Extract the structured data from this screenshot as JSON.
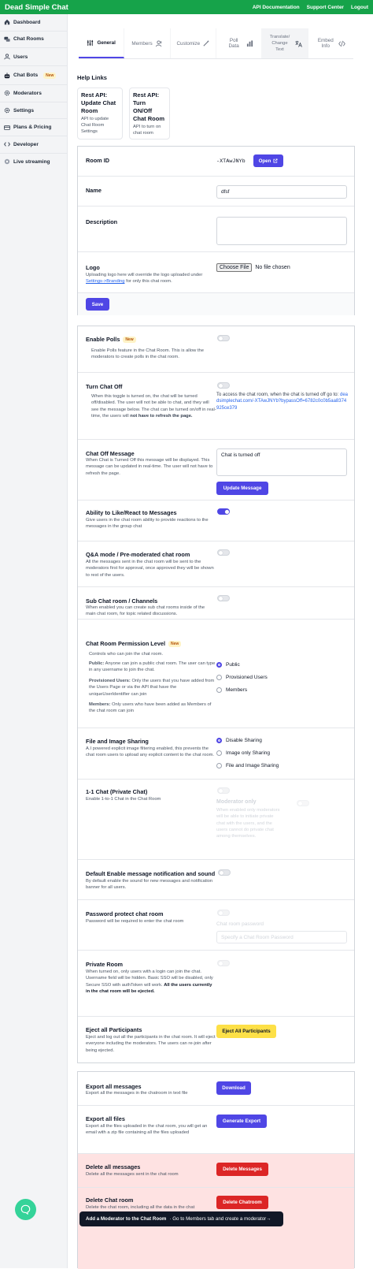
{
  "header": {
    "brand": "Dead Simple Chat",
    "links": [
      "API Documentation",
      "Support Center",
      "Logout"
    ]
  },
  "sidebar": {
    "items": [
      {
        "label": "Dashboard",
        "icon": "home-icon"
      },
      {
        "label": "Chat Rooms",
        "icon": "chat-bubbles-icon"
      },
      {
        "label": "Users",
        "icon": "users-icon"
      },
      {
        "label": "Chat Bots",
        "icon": "bot-icon",
        "badge": "New"
      },
      {
        "label": "Moderators",
        "icon": "gear-icon"
      },
      {
        "label": "Settings",
        "icon": "gear-icon"
      },
      {
        "label": "Plans & Pricing",
        "icon": "credit-card-icon"
      },
      {
        "label": "Developer",
        "icon": "code-icon"
      },
      {
        "label": "Live streaming",
        "icon": "broadcast-icon"
      }
    ]
  },
  "tabs": [
    {
      "label": "General",
      "icon": "sliders-icon",
      "active": true
    },
    {
      "label": "Members",
      "icon": "users-icon"
    },
    {
      "label": "Customize",
      "icon": "wand-icon"
    },
    {
      "label": "Poll Data",
      "icon": "bar-chart-icon"
    },
    {
      "label": "Translate/ Change Text",
      "icon": "translate-icon"
    },
    {
      "label": "Embed Info",
      "icon": "code-icon"
    }
  ],
  "help": {
    "title": "Help Links",
    "cards": [
      {
        "title": "Rest API: Update Chat Room",
        "desc": "API to update Chat Room Settings"
      },
      {
        "title": "Rest API: Turn ON/Off Chat Room",
        "desc": "API to turn on chat room"
      }
    ]
  },
  "basic": {
    "room_id_label": "Room ID",
    "room_id_value": "-XTAwJNYb",
    "open_label": "Open",
    "name_label": "Name",
    "name_value": "dfsf",
    "description_label": "Description",
    "description_value": "",
    "logo_label": "Logo",
    "logo_desc_pre": "Uploading logo here will override the logo uploaded under ",
    "logo_desc_link": "Settings->Branding",
    "logo_desc_post": " for only this chat room.",
    "file_button": "Choose File",
    "file_status": "No file chosen",
    "save_label": "Save"
  },
  "features": {
    "polls": {
      "label": "Enable Polls",
      "badge": "New",
      "desc": "Enable Polls feature in the Chat Room. This is allow the moderators to create polls in the chat room."
    },
    "chat_off": {
      "label": "Turn Chat Off",
      "desc_plain": "When this toggle is turned on, the chat will be turned off/disabled. The user will not be able to chat, and they will see the message below. The chat can be turned on/off in real-time, the users will ",
      "desc_bold": "not have to refresh the page.",
      "access_text": "To access the chat room, when the chat is turned off go to: ",
      "access_link": "deadsimplechat.com/-XTAwJNYb?bypassOff=6782c0c0b5aa8374925ce379"
    },
    "chat_off_message": {
      "label": "Chat Off Message",
      "desc": "When Chat is Turned Off this message will be displayed. This message can be updated in real-time. The user will not have to refresh the page.",
      "value": "Chat is turned off",
      "button": "Update Message"
    },
    "like": {
      "label": "Ability to Like/React to Messages",
      "desc": "Give users in the chat room ability to provide reactions to the messages in the group chat"
    },
    "qa": {
      "label": "Q&A mode / Pre-moderated chat room",
      "desc": "All the messages sent in the chat room will be sent to the moderators first for approval, once approved they will be shown to rest of the users."
    },
    "sub_rooms": {
      "label": "Sub Chat room / Channels",
      "desc": "When enabled you can create sub chat rooms inside of the main chat room, for topic related discussions."
    },
    "permission": {
      "label": "Chat Room Permission Level",
      "badge": "New",
      "desc": "Controls who can join the chat room.",
      "public_b": "Public:",
      "public_t": " Anyone can join a public chat room. The user can type in any username to join the chat.",
      "prov_b": "Provisioned Users:",
      "prov_t": " Only the users that you have added from the Users Page or via the API that have the uniqueUserIdentifier can join",
      "mem_b": "Members:",
      "mem_t": " Only users who have been added as Members of the chat room can join",
      "options": [
        "Public",
        "Provisioned Users",
        "Members"
      ]
    },
    "sharing": {
      "label": "File and Image Sharing",
      "desc": "A.I powered explicit image filtering enabled, this prevents the chat room users to upload any explicit content to the chat room.",
      "options": [
        "Disable Sharing",
        "Image only Sharing",
        "File and Image Sharing"
      ]
    },
    "private_chat": {
      "label": "1-1 Chat (Private Chat)",
      "desc": "Enable 1-to-1 Chat in the Chat Room",
      "mod_only": "Moderator only",
      "mod_desc": "When enabled only moderators will be able to initiate private chat with the users, and the users cannot do private chat among themselves."
    },
    "notify": {
      "label": "Default Enable message notification and sound",
      "desc": "By default enable the sound for new messages and notification banner for all users."
    },
    "password": {
      "label": "Password protect chat room",
      "desc": "Password will be required to enter the chat room",
      "field_label": "Chat room password",
      "placeholder": "Specify a Chat Room Password"
    },
    "private_room": {
      "label": "Private Room",
      "desc": "When turned on, only users with a login can join the chat. Username field will be hidden. Basic SSO will be disabled, only Secure SSO with authToken will work. ",
      "desc_bold": "All the users currently in the chat room will be ejected."
    },
    "eject": {
      "label": "Eject all Participants",
      "desc": "Eject and log out all the participants in the chat room. It will eject everyone including the moderators. The users can re-join after being ejected.",
      "button": "Eject All Participants"
    }
  },
  "exports": {
    "messages": {
      "label": "Export all messages",
      "desc": "Export all the messages in the chatroom in text file",
      "button": "Download"
    },
    "files": {
      "label": "Export all files",
      "desc": "Export all the files uploaded in the chat room, you will get an email with a zip file containing all the files uploaded",
      "button": "Generate Export"
    },
    "delete_messages": {
      "label": "Delete all messages",
      "desc": "Delete all the messages sent in the chat room",
      "button": "Delete Messages"
    },
    "delete_room": {
      "label": "Delete Chat room",
      "desc": "Delete the chat room, including all the data in the chat",
      "button": "Delete Chatroom"
    }
  },
  "toast": {
    "bold": "Add a Moderator to the Chat Room",
    "text": " · Go to Members tab and create a moderator→"
  },
  "colors": {
    "brand": "#16a34a",
    "accent": "#4f46e5",
    "danger": "#dc2626",
    "warning": "#fde047",
    "danger_bg": "#fee2e2"
  }
}
